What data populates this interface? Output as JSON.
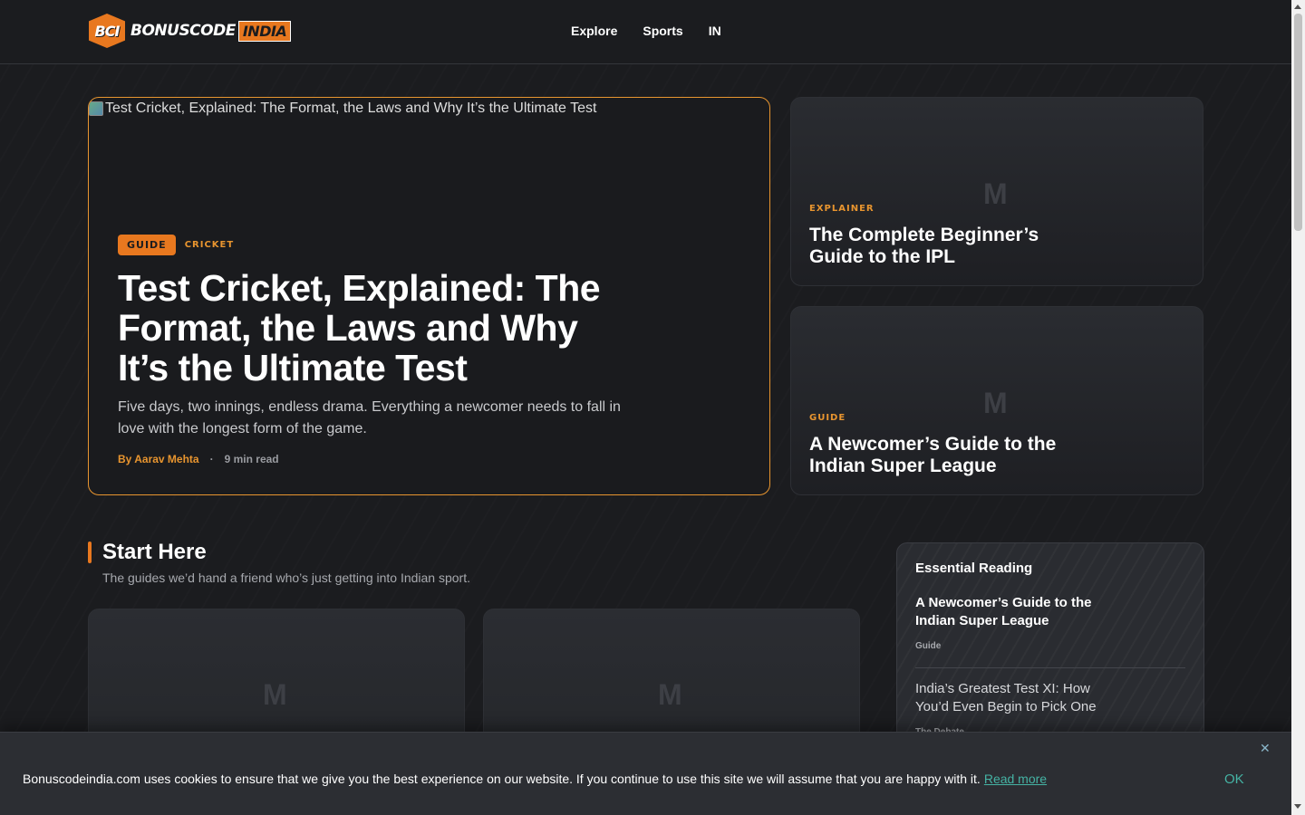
{
  "header": {
    "logo_badge": "BCI",
    "logo_text": "BONUSCODE",
    "logo_india": "INDIA",
    "nav": [
      "Explore",
      "Sports",
      "IN"
    ]
  },
  "hero": {
    "image_alt": "Test Cricket, Explained: The Format, the Laws and Why It’s the Ultimate Test",
    "badge": "GUIDE",
    "category": "CRICKET",
    "title": "Test Cricket, Explained: The Format, the Laws and Why It’s the Ultimate Test",
    "description": "Five days, two innings, endless drama. Everything a newcomer needs to fall in love with the longest form of the game.",
    "author": "By Aarav Mehta",
    "separator": "·",
    "read_time": "9 min read"
  },
  "side_cards": [
    {
      "placeholder": "M",
      "category": "EXPLAINER",
      "title": "The Complete Beginner’s Guide to the IPL"
    },
    {
      "placeholder": "M",
      "category": "GUIDE",
      "title": "A Newcomer’s Guide to the Indian Super League"
    }
  ],
  "start_here": {
    "title": "Start Here",
    "subtitle": "The guides we’d hand a friend who’s just getting into Indian sport.",
    "cards": [
      {
        "placeholder": "M"
      },
      {
        "placeholder": "M"
      }
    ]
  },
  "essential_reading": {
    "title": "Essential Reading",
    "items": [
      {
        "title": "A Newcomer’s Guide to the Indian Super League",
        "category": "Guide"
      },
      {
        "title": "India’s Greatest Test XI: How You’d Even Begin to Pick One",
        "category": "The Debate"
      }
    ]
  },
  "cookie": {
    "text": "Bonuscodeindia.com uses cookies to ensure that we give you the best experience on our website. If you continue to use this site we will assume that you are happy with it.",
    "read_more": "Read more",
    "ok": "OK",
    "close": "✕"
  },
  "colors": {
    "accent": "#e8781f",
    "accent_text": "#e8952f",
    "background": "#1b1c1f",
    "link_teal": "#45b3a4"
  }
}
